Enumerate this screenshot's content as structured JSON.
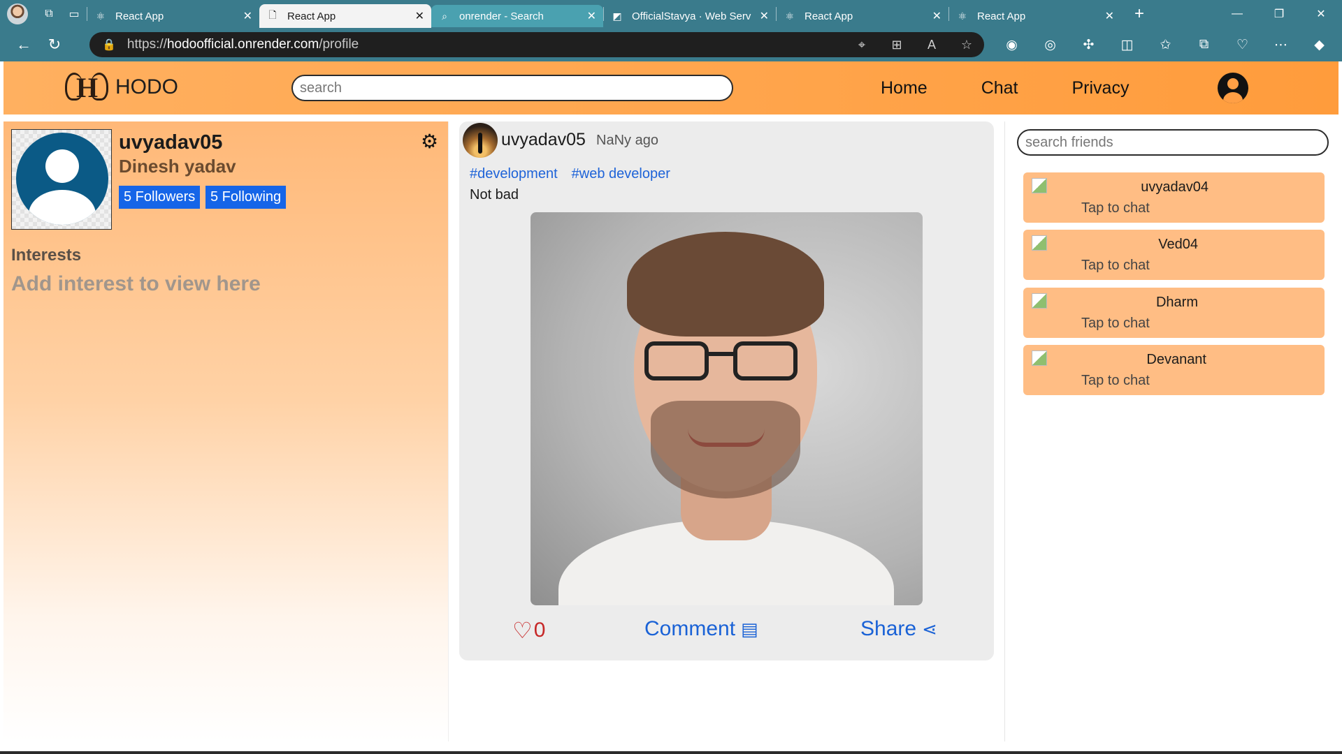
{
  "browser": {
    "tabs": [
      {
        "title": "React App",
        "favicon": "react-icon"
      },
      {
        "title": "React App",
        "favicon": "page-icon"
      },
      {
        "title": "onrender - Search",
        "favicon": "search-icon"
      },
      {
        "title": "OfficialStavya · Web Serv",
        "favicon": "render-icon"
      },
      {
        "title": "React App",
        "favicon": "react-icon"
      },
      {
        "title": "React App",
        "favicon": "react-icon"
      }
    ],
    "url_scheme": "https://",
    "url_host": "hodoofficial.onrender.com",
    "url_path": "/profile"
  },
  "header": {
    "logo_text": "HODO",
    "search_placeholder": "search",
    "nav": {
      "home": "Home",
      "chat": "Chat",
      "privacy": "Privacy"
    },
    "accent_color": "#ff9c3c"
  },
  "profile": {
    "username": "uvyadav05",
    "fullname": "Dinesh yadav",
    "followers_label": "5 Followers",
    "following_label": "5 Following",
    "interests_title": "Interests",
    "interests_empty": "Add interest to view here"
  },
  "post": {
    "username": "uvyadav05",
    "time": "NaNy ago",
    "tags": [
      "#development",
      "#web developer"
    ],
    "text": "Not bad",
    "likes": "0",
    "comment_label": "Comment",
    "share_label": "Share"
  },
  "friends": {
    "search_placeholder": "search friends",
    "list": [
      {
        "name": "uvyadav04",
        "sub": "Tap to chat"
      },
      {
        "name": "Ved04",
        "sub": "Tap to chat"
      },
      {
        "name": "Dharm",
        "sub": "Tap to chat"
      },
      {
        "name": "Devanant",
        "sub": "Tap to chat"
      }
    ]
  }
}
